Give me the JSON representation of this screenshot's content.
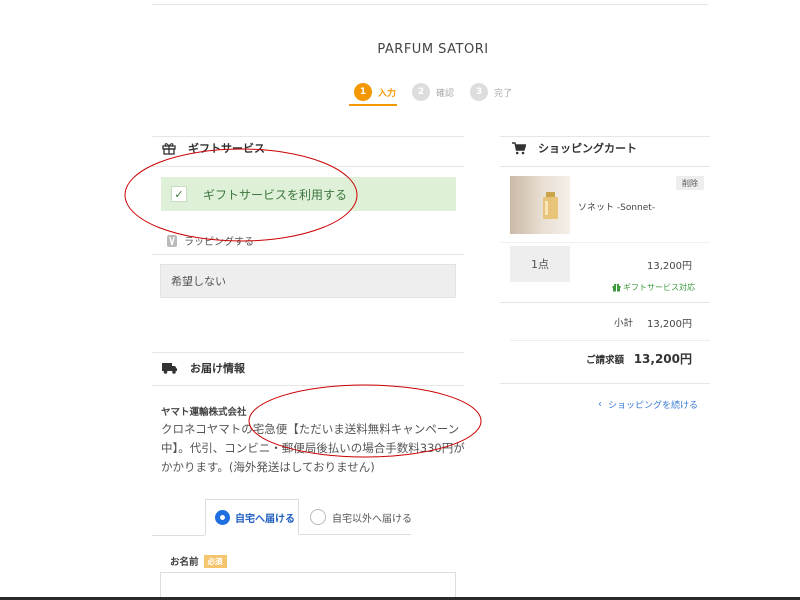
{
  "header": {
    "brand": "PARFUM SATORI",
    "steps": [
      {
        "num": "1",
        "label": "入力"
      },
      {
        "num": "2",
        "label": "確認"
      },
      {
        "num": "3",
        "label": "完了"
      }
    ]
  },
  "gift": {
    "title": "ギフトサービス",
    "checkbox_label": "ギフトサービスを利用する",
    "wrapping_label": "ラッピングする",
    "wrapping_value": "希望しない"
  },
  "delivery": {
    "title": "お届け情報",
    "carrier_name": "ヤマト運輸株式会社",
    "carrier_note": "クロネコヤマトの宅急便【ただいま送料無料キャンペーン中】。代引、コンビニ・郵便局後払いの場合手数料330円がかかります。(海外発送はしておりません)",
    "tabs": [
      {
        "label": "自宅へ届ける"
      },
      {
        "label": "自宅以外へ届ける"
      }
    ],
    "name_label": "お名前",
    "required_badge": "必須"
  },
  "cart": {
    "title": "ショッピングカート",
    "item": {
      "name": "ソネット -Sonnet-",
      "delete": "削除",
      "qty": "1点",
      "price": "13,200円",
      "gift_ok": "ギフトサービス対応"
    },
    "subtotal_label": "小計",
    "subtotal_value": "13,200円",
    "total_label": "ご請求額",
    "total_value": "13,200円",
    "continue_link": "ショッピングを続ける"
  },
  "colors": {
    "accent": "#f39800",
    "gift_bg": "#dff0d8",
    "gift_text": "#3c763d",
    "link": "#3a7bd5",
    "annotation": "#cc0000"
  }
}
